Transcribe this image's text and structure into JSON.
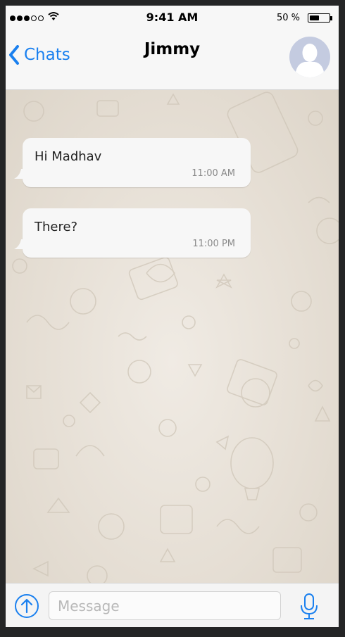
{
  "status_bar": {
    "signal_icon": "signal-dots-icon",
    "wifi_icon": "wifi-icon",
    "time": "9:41 AM",
    "battery_percent": "50 %",
    "battery_level": 0.5
  },
  "nav_bar": {
    "back_label": "Chats",
    "back_icon": "chevron-left-icon",
    "title": "Jimmy",
    "avatar_icon": "person-avatar-icon",
    "accent_color": "#1a80ef"
  },
  "messages": [
    {
      "text": "Hi Madhav",
      "time": "11:00 AM"
    },
    {
      "text": "There?",
      "time": "11:00 PM"
    }
  ],
  "input_bar": {
    "placeholder": "Message",
    "upload_icon": "upload-arrow-icon",
    "mic_icon": "microphone-icon"
  }
}
